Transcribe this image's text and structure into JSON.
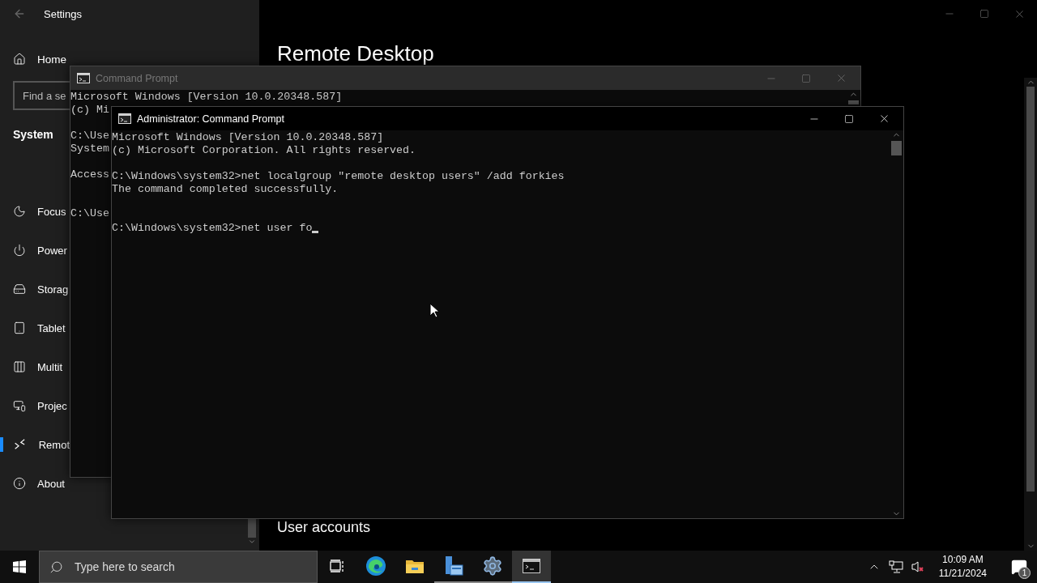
{
  "settings": {
    "title": "Settings",
    "home": "Home",
    "search": {
      "placeholder": "Find a se"
    },
    "section": "System",
    "items": [
      {
        "label": "Focus",
        "selected": false
      },
      {
        "label": "Power",
        "selected": false
      },
      {
        "label": "Storag",
        "selected": false
      },
      {
        "label": "Tablet",
        "selected": false
      },
      {
        "label": "Multit",
        "selected": false
      },
      {
        "label": "Projec",
        "selected": false
      },
      {
        "label": "Remot",
        "selected": true
      },
      {
        "label": "About",
        "selected": false
      }
    ],
    "heading": "Remote Desktop",
    "subheading": "User accounts"
  },
  "console_back": {
    "title": "Command Prompt",
    "active": false,
    "lines": [
      {
        "kind": "text",
        "text": "Microsoft Windows [Version 10.0.20348.587]"
      },
      {
        "kind": "text",
        "text": "(c) Mi"
      },
      {
        "kind": "blank"
      },
      {
        "kind": "text",
        "text": "C:\\Use"
      },
      {
        "kind": "text",
        "text": "System"
      },
      {
        "kind": "blank"
      },
      {
        "kind": "text",
        "text": "Access"
      },
      {
        "kind": "blank"
      },
      {
        "kind": "blank"
      },
      {
        "kind": "text",
        "text": "C:\\Use"
      }
    ]
  },
  "console_front": {
    "title": "Administrator: Command Prompt",
    "active": true,
    "lines": [
      {
        "kind": "text",
        "text": "Microsoft Windows [Version 10.0.20348.587]"
      },
      {
        "kind": "text",
        "text": "(c) Microsoft Corporation. All rights reserved."
      },
      {
        "kind": "blank"
      },
      {
        "kind": "text",
        "text": "C:\\Windows\\system32>net localgroup \"remote desktop users\" /add forkies"
      },
      {
        "kind": "text",
        "text": "The command completed successfully."
      },
      {
        "kind": "blank"
      },
      {
        "kind": "blank"
      },
      {
        "kind": "input",
        "text": "C:\\Windows\\system32>net user fo"
      }
    ]
  },
  "taskbar": {
    "search": {
      "placeholder": "Type here to search"
    },
    "apps": [
      {
        "kind": "task-view",
        "running": false,
        "selected": false
      },
      {
        "kind": "browser",
        "running": false,
        "selected": false
      },
      {
        "kind": "folder",
        "running": false,
        "selected": false
      },
      {
        "kind": "server",
        "running": true,
        "selected": false
      },
      {
        "kind": "gear",
        "running": true,
        "selected": false
      },
      {
        "kind": "console",
        "running": true,
        "selected": true
      }
    ],
    "clock": {
      "time": "10:09 AM",
      "date": "11/21/2024"
    },
    "notifications": "1"
  }
}
